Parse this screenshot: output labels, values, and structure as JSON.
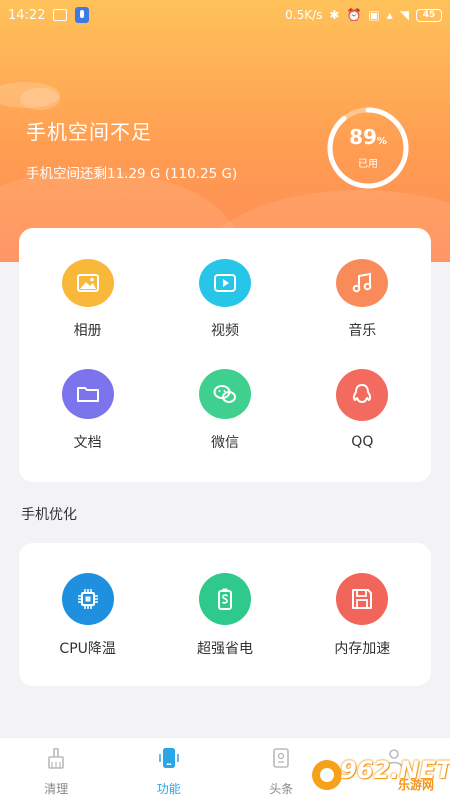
{
  "status_bar": {
    "time": "14:22",
    "speed": "0.5K/s",
    "battery": "45"
  },
  "header": {
    "title": "手机空间不足",
    "subtitle": "手机空间还剩11.29 G (110.25 G)",
    "usage_percent": 89,
    "usage_unit": "%",
    "usage_label": "已用"
  },
  "apps": [
    {
      "label": "相册",
      "icon": "photo-icon",
      "color": "#f9b83a"
    },
    {
      "label": "视频",
      "icon": "video-icon",
      "color": "#27c6e8"
    },
    {
      "label": "音乐",
      "icon": "music-icon",
      "color": "#f98b5a"
    },
    {
      "label": "文档",
      "icon": "folder-icon",
      "color": "#7b74ec"
    },
    {
      "label": "微信",
      "icon": "wechat-icon",
      "color": "#3fd08f"
    },
    {
      "label": "QQ",
      "icon": "qq-icon",
      "color": "#f36a5e"
    }
  ],
  "optimize": {
    "section_title": "手机优化",
    "items": [
      {
        "label": "CPU降温",
        "icon": "cpu-icon",
        "color": "#1f8fe0"
      },
      {
        "label": "超强省电",
        "icon": "battery-save-icon",
        "color": "#2fc98b"
      },
      {
        "label": "内存加速",
        "icon": "memory-icon",
        "color": "#f2655a"
      }
    ]
  },
  "nav": {
    "items": [
      {
        "label": "清理",
        "icon": "broom-icon"
      },
      {
        "label": "功能",
        "icon": "phone-icon",
        "active": true
      },
      {
        "label": "头条",
        "icon": "news-icon"
      },
      {
        "label": "",
        "icon": "profile-icon"
      }
    ]
  },
  "watermark": {
    "brand": "962",
    "net": ".NET",
    "site": "乐游网"
  },
  "colors": {
    "header_top": "#ffc25a",
    "header_bottom": "#ff8a55",
    "accent_active": "#2aa6e6"
  }
}
